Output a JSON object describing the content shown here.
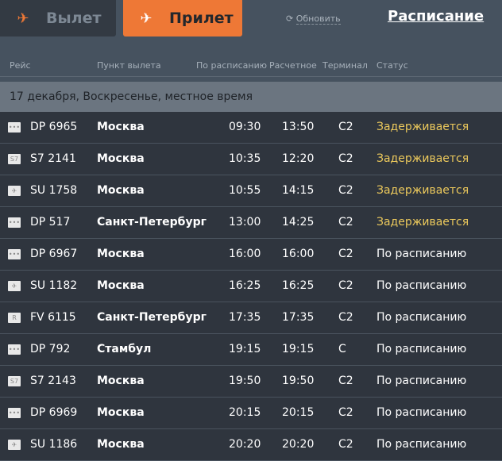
{
  "tabs": {
    "departure": "Вылет",
    "arrival": "Прилет"
  },
  "refresh": "Обновить",
  "schedule_link": "Расписание",
  "columns": [
    "Рейс",
    "Пункт вылета",
    "По расписанию",
    "Расчетное",
    "Терминал",
    "Статус"
  ],
  "date_header": "17 декабря, Воскресенье, местное время",
  "flights": [
    {
      "logo": "DP",
      "flight": "DP 6965",
      "city": "Москва",
      "sched": "09:30",
      "est": "13:50",
      "term": "C2",
      "status": "Задерживается",
      "delayed": true
    },
    {
      "logo": "S7",
      "flight": "S7 2141",
      "city": "Москва",
      "sched": "10:35",
      "est": "12:20",
      "term": "C2",
      "status": "Задерживается",
      "delayed": true
    },
    {
      "logo": "SU",
      "flight": "SU 1758",
      "city": "Москва",
      "sched": "10:55",
      "est": "14:15",
      "term": "C2",
      "status": "Задерживается",
      "delayed": true
    },
    {
      "logo": "DP",
      "flight": "DP 517",
      "city": "Санкт-Петербург",
      "sched": "13:00",
      "est": "14:25",
      "term": "C2",
      "status": "Задерживается",
      "delayed": true
    },
    {
      "logo": "DP",
      "flight": "DP 6967",
      "city": "Москва",
      "sched": "16:00",
      "est": "16:00",
      "term": "C2",
      "status": "По расписанию",
      "delayed": false
    },
    {
      "logo": "SU",
      "flight": "SU 1182",
      "city": "Москва",
      "sched": "16:25",
      "est": "16:25",
      "term": "C2",
      "status": "По расписанию",
      "delayed": false
    },
    {
      "logo": "FV",
      "flight": "FV 6115",
      "city": "Санкт-Петербург",
      "sched": "17:35",
      "est": "17:35",
      "term": "C2",
      "status": "По расписанию",
      "delayed": false
    },
    {
      "logo": "DP",
      "flight": "DP 792",
      "city": "Стамбул",
      "sched": "19:15",
      "est": "19:15",
      "term": "C",
      "status": "По расписанию",
      "delayed": false
    },
    {
      "logo": "S7",
      "flight": "S7 2143",
      "city": "Москва",
      "sched": "19:50",
      "est": "19:50",
      "term": "C2",
      "status": "По расписанию",
      "delayed": false
    },
    {
      "logo": "DP",
      "flight": "DP 6969",
      "city": "Москва",
      "sched": "20:15",
      "est": "20:15",
      "term": "C2",
      "status": "По расписанию",
      "delayed": false
    },
    {
      "logo": "SU",
      "flight": "SU 1186",
      "city": "Москва",
      "sched": "20:20",
      "est": "20:20",
      "term": "C2",
      "status": "По расписанию",
      "delayed": false
    }
  ]
}
